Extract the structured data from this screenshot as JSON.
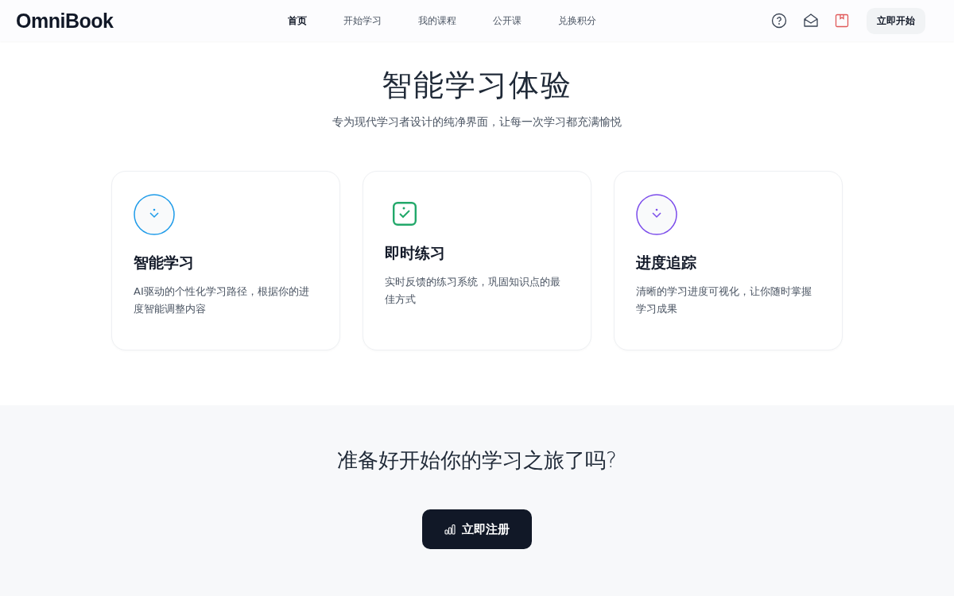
{
  "header": {
    "logo": "OmniBook",
    "nav": [
      {
        "label": "首页",
        "selected": true
      },
      {
        "label": "开始学习",
        "selected": false
      },
      {
        "label": "我的课程",
        "selected": false
      },
      {
        "label": "公开课",
        "selected": false
      },
      {
        "label": "兑换积分",
        "selected": false
      }
    ],
    "cta": "立即开始"
  },
  "features": {
    "title": "智能学习体验",
    "subtitle": "专为现代学习者设计的纯净界面，让每一次学习都充满愉悦",
    "cards": [
      {
        "kind": "circle",
        "color": "#1e9be9",
        "title": "智能学习",
        "text": "AI驱动的个性化学习路径，根据你的进度智能调整内容"
      },
      {
        "kind": "square",
        "color": "#22a86a",
        "title": "即时练习",
        "text": "实时反馈的练习系统，巩固知识点的最佳方式"
      },
      {
        "kind": "circle",
        "color": "#7c4deb",
        "title": "进度追踪",
        "text": "清晰的学习进度可视化，让你随时掌握学习成果"
      }
    ]
  },
  "signup": {
    "title": "准备好开始你的学习之旅了吗?",
    "button": "立即注册"
  }
}
